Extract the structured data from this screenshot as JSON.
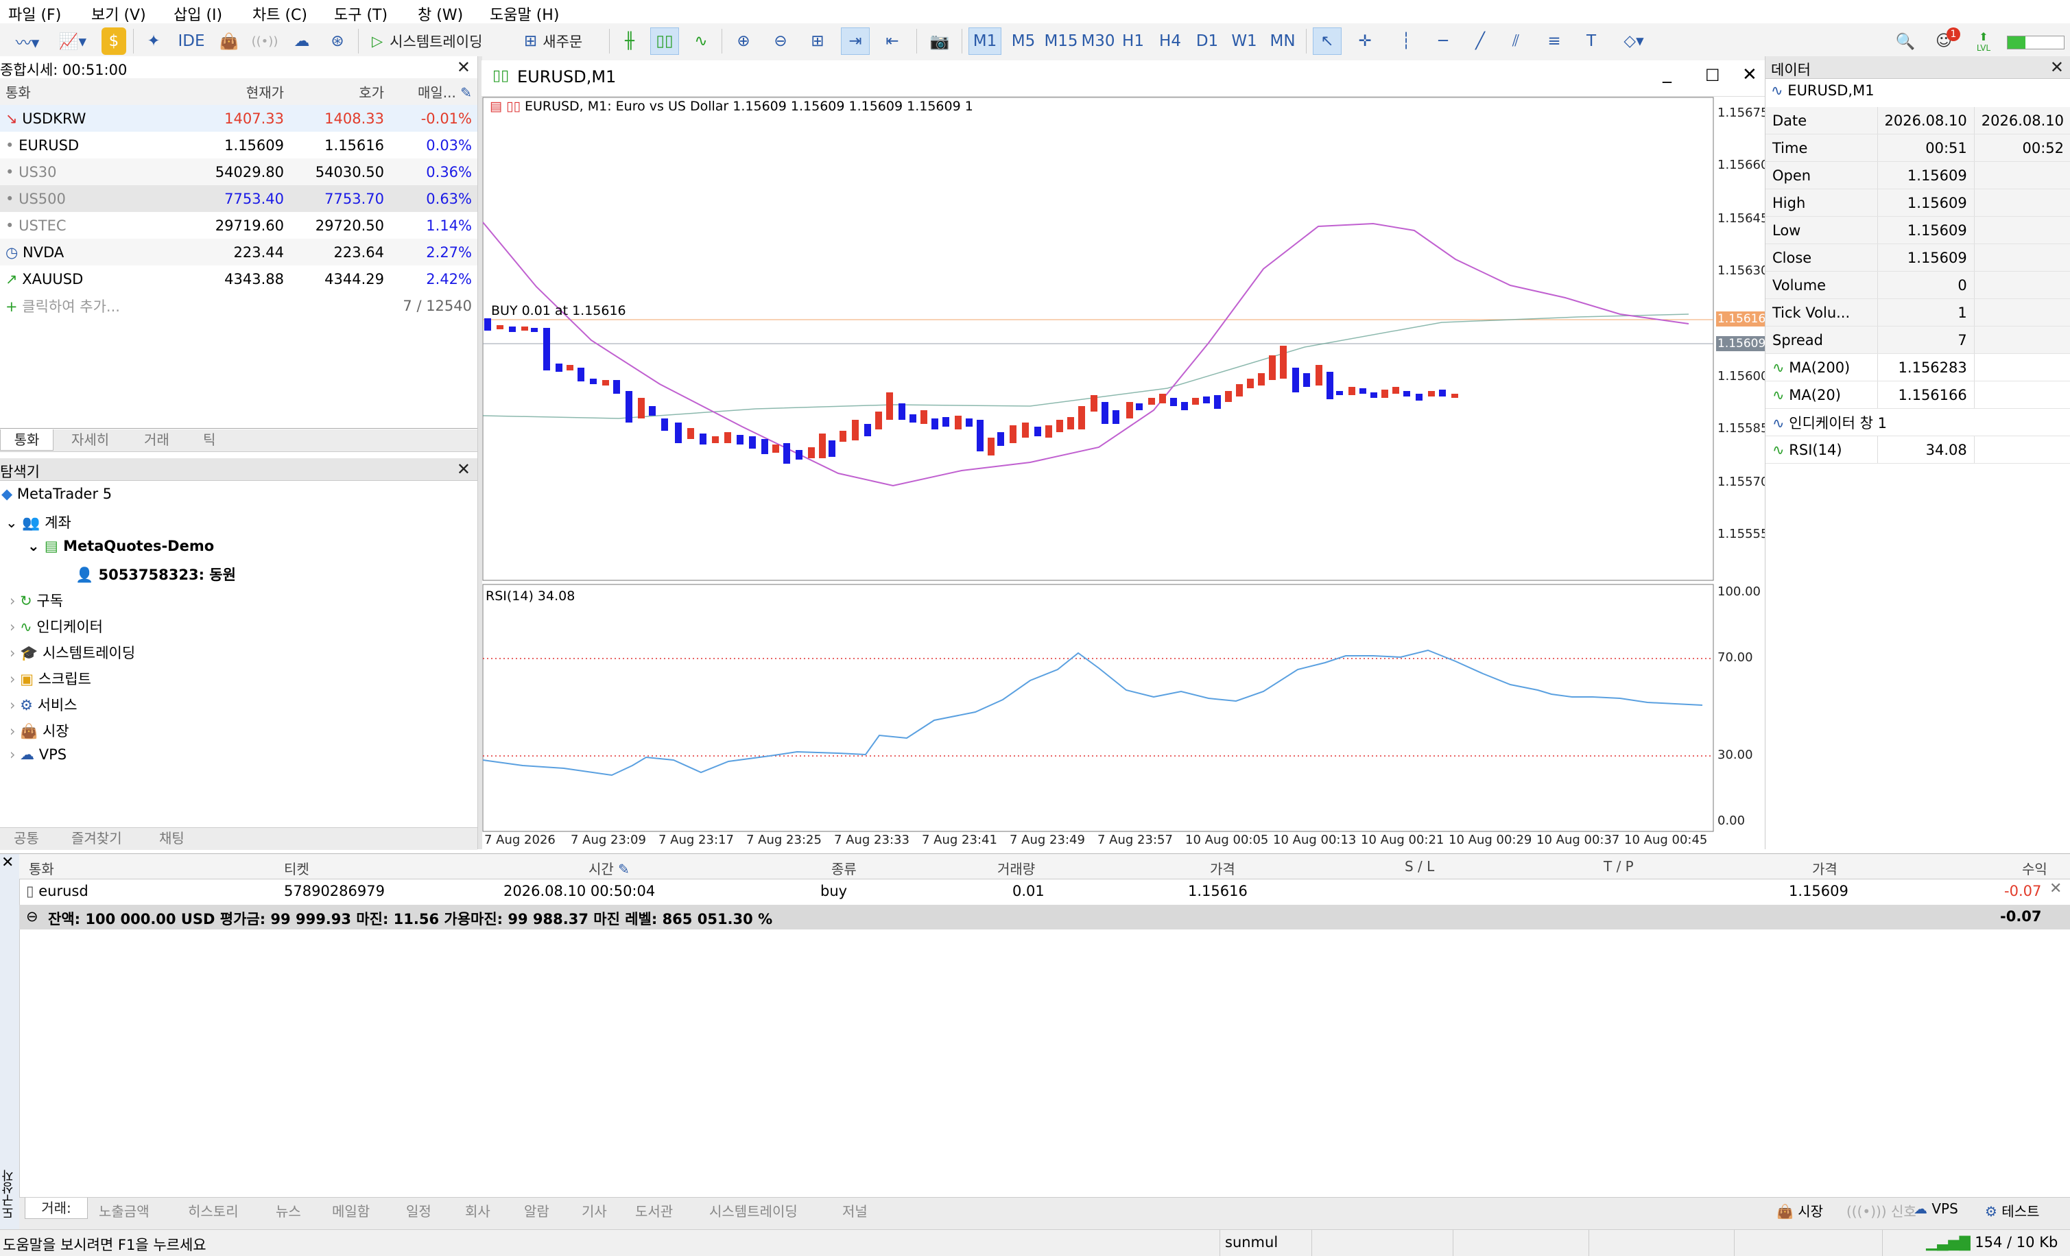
{
  "menu": [
    "파일 (F)",
    "보기 (V)",
    "삽입 (I)",
    "차트 (C)",
    "도구 (T)",
    "창 (W)",
    "도움말 (H)"
  ],
  "toolbar": {
    "ide": "IDE",
    "algo": "시스템트레이딩",
    "new_order": "새주문",
    "timeframes": [
      "M1",
      "M5",
      "M15",
      "M30",
      "H1",
      "H4",
      "D1",
      "W1",
      "MN"
    ],
    "notification_count": "1",
    "lvl": "LVL"
  },
  "market_watch": {
    "title": "종합시세: 00:51:00",
    "columns": [
      "통화",
      "현재가",
      "호가",
      "매일..."
    ],
    "rows": [
      {
        "symbol": "USDKRW",
        "bid": "1407.33",
        "ask": "1408.33",
        "daily": "-0.01%",
        "icon": "arrow-down-icon"
      },
      {
        "symbol": "EURUSD",
        "bid": "1.15609",
        "ask": "1.15616",
        "daily": "0.03%",
        "icon": "dot-icon"
      },
      {
        "symbol": "US30",
        "bid": "54029.80",
        "ask": "54030.50",
        "daily": "0.36%",
        "icon": "dot-icon"
      },
      {
        "symbol": "US500",
        "bid": "7753.40",
        "ask": "7753.70",
        "daily": "0.63%",
        "icon": "dot-icon"
      },
      {
        "symbol": "USTEC",
        "bid": "29719.60",
        "ask": "29720.50",
        "daily": "1.14%",
        "icon": "dot-icon"
      },
      {
        "symbol": "NVDA",
        "bid": "223.44",
        "ask": "223.64",
        "daily": "2.27%",
        "icon": "clock-icon"
      },
      {
        "symbol": "XAUUSD",
        "bid": "4343.88",
        "ask": "4344.29",
        "daily": "2.42%",
        "icon": "arrow-up-icon"
      }
    ],
    "add_label": "클릭하여 추가...",
    "count": "7 / 12540",
    "tabs": [
      "통화",
      "자세히",
      "거래",
      "틱"
    ]
  },
  "navigator": {
    "title": "탐색기",
    "root": "MetaTrader 5",
    "accounts": "계좌",
    "server": "MetaQuotes-Demo",
    "account": "5053758323: 동원",
    "items": [
      "구독",
      "인디케이터",
      "시스템트레이딩",
      "스크립트",
      "서비스",
      "시장",
      "VPS"
    ],
    "tabs": [
      "공통",
      "즐겨찾기",
      "채팅"
    ]
  },
  "chart": {
    "window_title": "EURUSD,M1",
    "info": "EURUSD, M1:  Euro vs US Dollar  1.15609 1.15609 1.15609 1.15609  1",
    "buy_label": "BUY 0.01 at 1.15616",
    "ask_tag": "1.15616",
    "bid_tag": "1.15609",
    "price_ticks": [
      "1.15675",
      "1.15660",
      "1.15645",
      "1.15630",
      "1.15600",
      "1.15585",
      "1.15570",
      "1.15555"
    ],
    "rsi_label": "RSI(14) 34.08",
    "rsi_ticks": [
      "100.00",
      "70.00",
      "30.00",
      "0.00"
    ],
    "time_ticks": [
      "7 Aug 2026",
      "7 Aug 23:09",
      "7 Aug 23:17",
      "7 Aug 23:25",
      "7 Aug 23:33",
      "7 Aug 23:41",
      "7 Aug 23:49",
      "7 Aug 23:57",
      "10 Aug 00:05",
      "10 Aug 00:13",
      "10 Aug 00:21",
      "10 Aug 00:29",
      "10 Aug 00:37",
      "10 Aug 00:45"
    ]
  },
  "data_window": {
    "title": "데이터",
    "symbol": "EURUSD,M1",
    "rows": [
      {
        "k": "Date",
        "v1": "2026.08.10",
        "v2": "2026.08.10"
      },
      {
        "k": "Time",
        "v1": "00:51",
        "v2": "00:52"
      },
      {
        "k": "Open",
        "v1": "1.15609",
        "v2": ""
      },
      {
        "k": "High",
        "v1": "1.15609",
        "v2": ""
      },
      {
        "k": "Low",
        "v1": "1.15609",
        "v2": ""
      },
      {
        "k": "Close",
        "v1": "1.15609",
        "v2": ""
      },
      {
        "k": "Volume",
        "v1": "0",
        "v2": ""
      },
      {
        "k": "Tick Volu...",
        "v1": "1",
        "v2": ""
      },
      {
        "k": "Spread",
        "v1": "7",
        "v2": ""
      },
      {
        "k": "MA(200)",
        "v1": "1.156283",
        "v2": ""
      },
      {
        "k": "MA(20)",
        "v1": "1.156166",
        "v2": ""
      },
      {
        "k": "인디케이터 창 1",
        "v1": "",
        "v2": ""
      },
      {
        "k": "RSI(14)",
        "v1": "34.08",
        "v2": ""
      }
    ]
  },
  "toolbox": {
    "headers": [
      "통화",
      "티켓",
      "시간",
      "종류",
      "거래량",
      "가격",
      "S / L",
      "T / P",
      "가격",
      "수익"
    ],
    "position": {
      "symbol": "eurusd",
      "ticket": "57890286979",
      "time": "2026.08.10 00:50:04",
      "type": "buy",
      "volume": "0.01",
      "price": "1.15616",
      "sl": "",
      "tp": "",
      "current": "1.15609",
      "profit": "-0.07"
    },
    "summary": "잔액: 100 000.00 USD  평가금: 99 999.93  마진: 11.56  가용마진: 99 988.37  마진 레벨: 865 051.30 %",
    "summary_profit": "-0.07",
    "tabs": [
      "거래:",
      "노출금액",
      "히스토리",
      "뉴스",
      "메일함",
      "일정",
      "회사",
      "알람",
      "기사",
      "도서관",
      "시스템트레이딩",
      "저널"
    ],
    "side_label": "도구상자",
    "right": {
      "market": "시장",
      "signal": "(((•))) 신호",
      "vps": "VPS",
      "tester": "테스트"
    }
  },
  "status": {
    "help": "도움말을 보시려면 F1을 누르세요",
    "profile": "sunmul",
    "traffic": "154 / 10 Kb"
  },
  "colors": {
    "up": "#e23b2a",
    "down": "#1a1ae6",
    "ma20": "#c060d0",
    "ma200": "#5a9a8a",
    "rsi": "#5aa0e0",
    "accent": "#2a5aa8"
  }
}
